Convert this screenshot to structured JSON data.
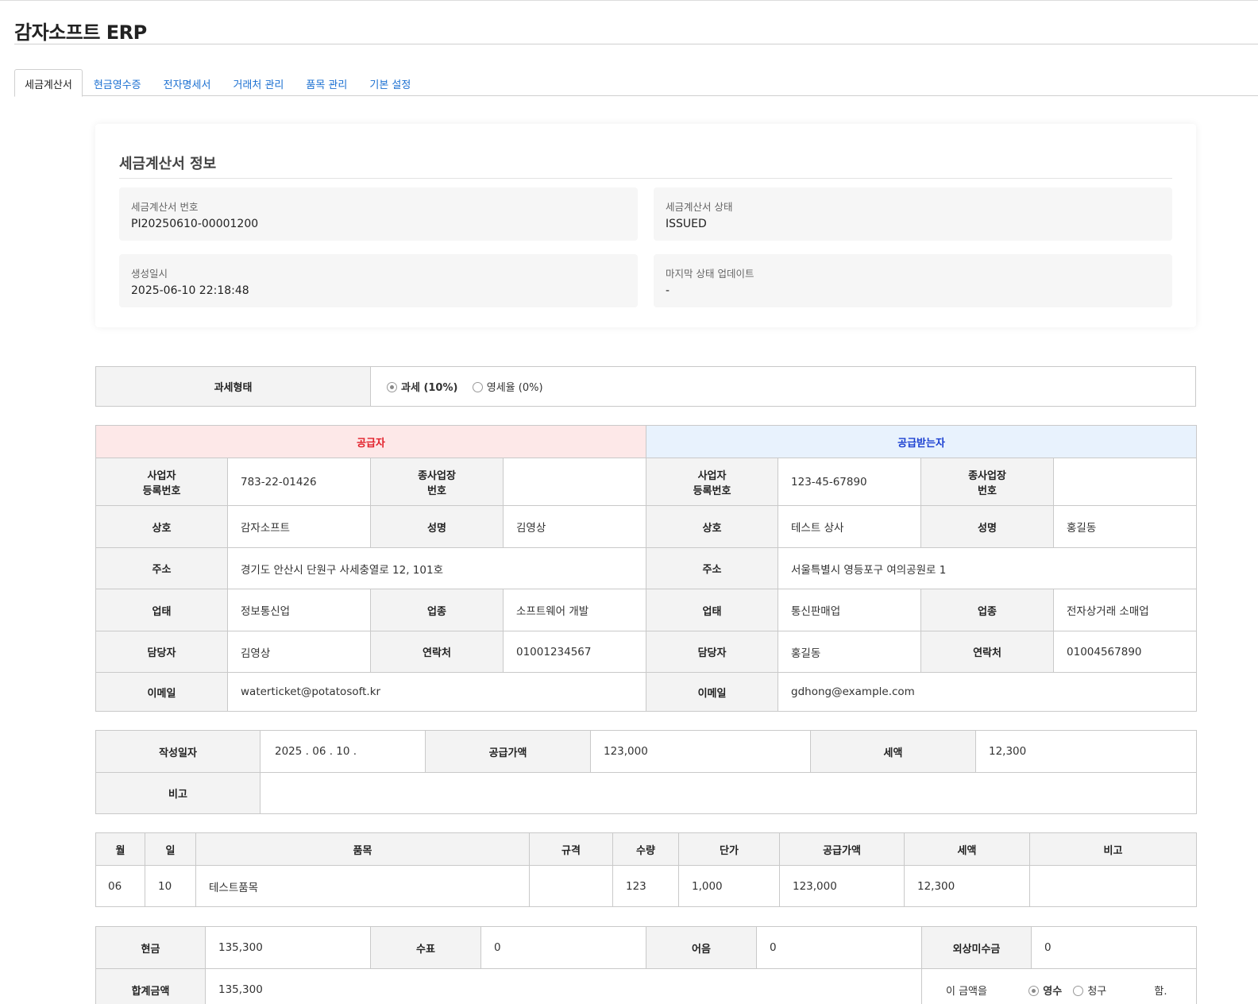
{
  "app": {
    "title": "감자소프트 ERP"
  },
  "tabs": [
    {
      "label": "세금계산서",
      "active": true
    },
    {
      "label": "현금영수증",
      "active": false
    },
    {
      "label": "전자명세서",
      "active": false
    },
    {
      "label": "거래처 관리",
      "active": false
    },
    {
      "label": "품목 관리",
      "active": false
    },
    {
      "label": "기본 설정",
      "active": false
    }
  ],
  "info": {
    "title": "세금계산서 정보",
    "invoice_no_label": "세금계산서 번호",
    "invoice_no": "PI20250610-00001200",
    "status_label": "세금계산서 상태",
    "status": "ISSUED",
    "created_label": "생성일시",
    "created": "2025-06-10 22:18:48",
    "last_update_label": "마지막 상태 업데이트",
    "last_update": "-"
  },
  "tax_type": {
    "label": "과세형태",
    "options": [
      {
        "label": "과세 (10%)",
        "selected": true
      },
      {
        "label": "영세율 (0%)",
        "selected": false
      }
    ]
  },
  "labels": {
    "supplier": "공급자",
    "buyer": "공급받는자",
    "biz_no_1": "사업자",
    "biz_no_2": "등록번호",
    "sub_biz_1": "종사업장",
    "sub_biz_2": "번호",
    "company": "상호",
    "name": "성명",
    "address": "주소",
    "biz_type": "업태",
    "biz_item": "업종",
    "manager": "담당자",
    "phone": "연락처",
    "email": "이메일"
  },
  "supplier": {
    "biz_no": "783-22-01426",
    "sub_biz_no": "",
    "company": "감자소프트",
    "name": "김영상",
    "address": "경기도 안산시 단원구 사세충열로 12, 101호",
    "biz_type": "정보통신업",
    "biz_item": "소프트웨어 개발",
    "manager": "김영상",
    "phone": "01001234567",
    "email": "waterticket@potatosoft.kr"
  },
  "buyer": {
    "biz_no": "123-45-67890",
    "sub_biz_no": "",
    "company": "테스트 상사",
    "name": "홍길동",
    "address": "서울특별시 영등포구 여의공원로 1",
    "biz_type": "통신판매업",
    "biz_item": "전자상거래 소매업",
    "manager": "홍길동",
    "phone": "01004567890",
    "email": "gdhong@example.com"
  },
  "summary": {
    "date_label": "작성일자",
    "date": "2025 . 06 . 10 .",
    "supply_label": "공급가액",
    "supply": "123,000",
    "tax_label": "세액",
    "tax": "12,300",
    "note_label": "비고",
    "note": ""
  },
  "items": {
    "headers": [
      "월",
      "일",
      "품목",
      "규격",
      "수량",
      "단가",
      "공급가액",
      "세액",
      "비고"
    ],
    "rows": [
      [
        "06",
        "10",
        "테스트품목",
        "",
        "123",
        "1,000",
        "123,000",
        "12,300",
        ""
      ]
    ]
  },
  "payment": {
    "cash_label": "현금",
    "cash": "135,300",
    "check_label": "수표",
    "check": "0",
    "note_label": "어음",
    "note": "0",
    "credit_label": "외상미수금",
    "credit": "0",
    "total_label": "합계금액",
    "total": "135,300",
    "amount_prefix": "이 금액을",
    "receipt_label": "영수",
    "receipt_selected": true,
    "claim_label": "청구",
    "claim_selected": false,
    "suffix": "함."
  }
}
